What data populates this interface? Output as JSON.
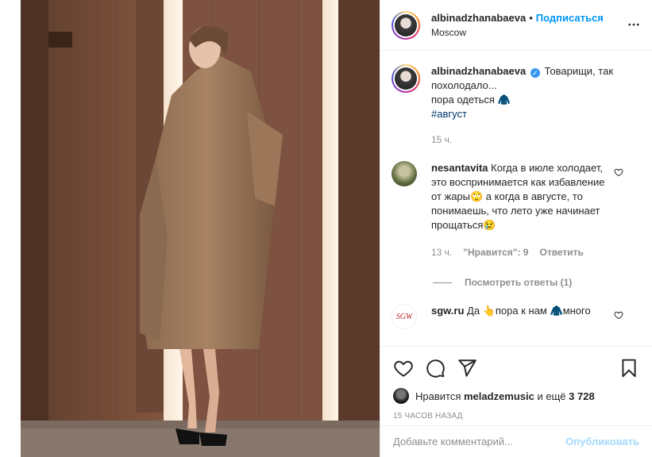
{
  "header": {
    "username": "albinadzhanabaeva",
    "separator": "•",
    "follow_label": "Подписаться",
    "location": "Moscow"
  },
  "caption": {
    "username": "albinadzhanabaeva",
    "text_line1": "Товарищи, так",
    "text_line2": "похолодало...",
    "text_line3": "пора одеться 🧥",
    "hashtag": "#август",
    "time": "15 ч."
  },
  "comments": [
    {
      "username": "nesantavita",
      "text": "Когда в июле холодает, это воспринимается как избавление от жары🙄 а когда в августе, то понимаешь, что лето уже начинает прощаться😢",
      "time": "13 ч.",
      "likes": "\"Нравится\": 9",
      "reply_label": "Ответить",
      "view_replies": "Посмотреть ответы (1)"
    },
    {
      "username": "sgw.ru",
      "avatar_text": "SGW",
      "text": "Да 👆пора к нам 🧥много"
    }
  ],
  "likes": {
    "prefix": "Нравится",
    "user": "meladzemusic",
    "middle": "и ещё",
    "count": "3 728"
  },
  "posted": "15 ЧАСОВ НАЗАД",
  "add_comment": {
    "placeholder": "Добавьте комментарий...",
    "publish_label": "Опубликовать"
  },
  "icons": {
    "more": "more-horizontal-icon",
    "verified": "verified-badge-icon",
    "heart": "heart-icon",
    "comment": "comment-icon",
    "share": "share-icon",
    "save": "bookmark-icon"
  },
  "colors": {
    "accent": "#0095f6",
    "verified": "#3897f0",
    "muted": "#8e8e8e"
  }
}
